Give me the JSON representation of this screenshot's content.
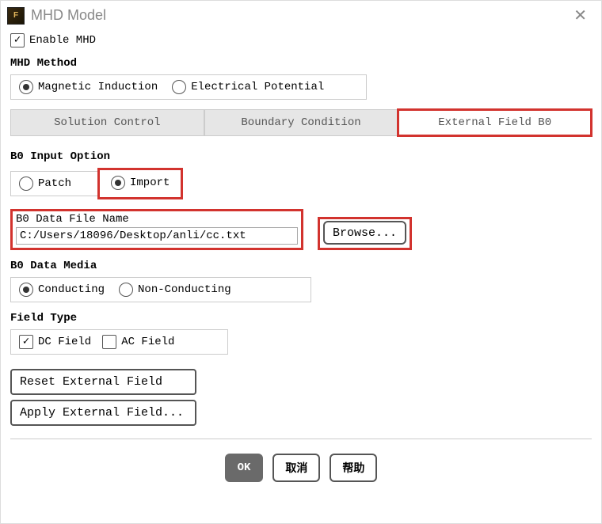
{
  "window": {
    "title": "MHD Model"
  },
  "enable": {
    "label": "Enable MHD",
    "checked": true
  },
  "method": {
    "heading": "MHD Method",
    "options": {
      "magnetic": "Magnetic Induction",
      "electrical": "Electrical Potential"
    },
    "selected": "magnetic"
  },
  "tabs": {
    "solution": "Solution Control",
    "boundary": "Boundary Condition",
    "external": "External Field B0",
    "active": "external"
  },
  "b0_input": {
    "heading": "B0 Input Option",
    "options": {
      "patch": "Patch",
      "import": "Import"
    },
    "selected": "import"
  },
  "file": {
    "label": "B0 Data File Name",
    "value": "C:/Users/18096/Desktop/anli/cc.txt",
    "browse": "Browse..."
  },
  "media": {
    "heading": "B0 Data Media",
    "options": {
      "conducting": "Conducting",
      "nonconducting": "Non-Conducting"
    },
    "selected": "conducting"
  },
  "field_type": {
    "heading": "Field Type",
    "dc": {
      "label": "DC Field",
      "checked": true
    },
    "ac": {
      "label": "AC Field",
      "checked": false
    }
  },
  "buttons": {
    "reset": "Reset External Field",
    "apply": "Apply External Field...",
    "ok": "OK",
    "cancel": "取消",
    "help": "帮助"
  }
}
